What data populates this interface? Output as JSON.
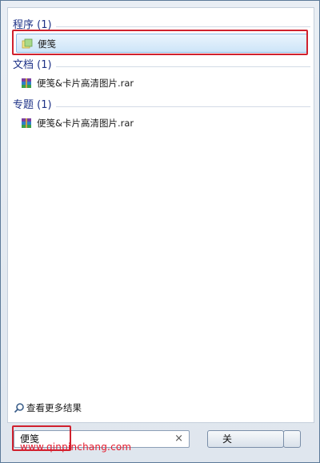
{
  "groups": [
    {
      "header": "程序 (1)",
      "items": [
        {
          "label": "便笺",
          "icon": "sticky-notes-icon",
          "selected": true
        }
      ]
    },
    {
      "header": "文档 (1)",
      "items": [
        {
          "label": "便笺&卡片高清图片.rar",
          "icon": "rar-archive-icon",
          "selected": false
        }
      ]
    },
    {
      "header": "专题 (1)",
      "items": [
        {
          "label": "便笺&卡片高清图片.rar",
          "icon": "rar-archive-icon",
          "selected": false
        }
      ]
    }
  ],
  "more_results": {
    "label": "查看更多结果",
    "icon": "search-icon"
  },
  "search": {
    "value": "便笺",
    "clear_icon": "×"
  },
  "shutdown": {
    "label": "关"
  },
  "watermark": "www.qinpinchang.com",
  "colors": {
    "highlight": "#d0212e",
    "header": "#1e3287",
    "selection": "#cde5f8"
  }
}
